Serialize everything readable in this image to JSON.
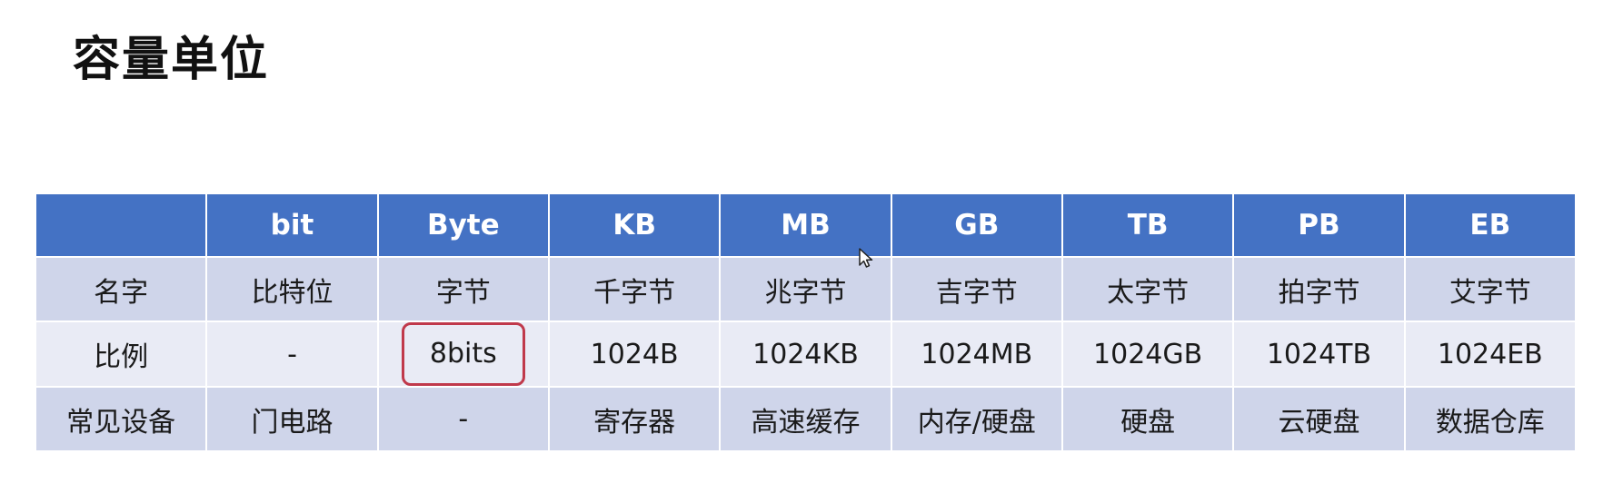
{
  "title": "容量单位",
  "table": {
    "headers": [
      "",
      "bit",
      "Byte",
      "KB",
      "MB",
      "GB",
      "TB",
      "PB",
      "EB"
    ],
    "rows": [
      [
        "名字",
        "比特位",
        "字节",
        "千字节",
        "兆字节",
        "吉字节",
        "太字节",
        "拍字节",
        "艾字节"
      ],
      [
        "比例",
        "-",
        "8bits",
        "1024B",
        "1024KB",
        "1024MB",
        "1024GB",
        "1024TB",
        "1024EB"
      ],
      [
        "常见设备",
        "门电路",
        "-",
        "寄存器",
        "高速缓存",
        "内存/硬盘",
        "硬盘",
        "云硬盘",
        "数据仓库"
      ]
    ]
  },
  "colors": {
    "header_bg": "#4472c4",
    "row_odd_bg": "#cfd5ea",
    "row_even_bg": "#e9ebf5",
    "highlight_border": "#c0394b"
  },
  "icons": {
    "cursor": "mouse-pointer-icon"
  }
}
